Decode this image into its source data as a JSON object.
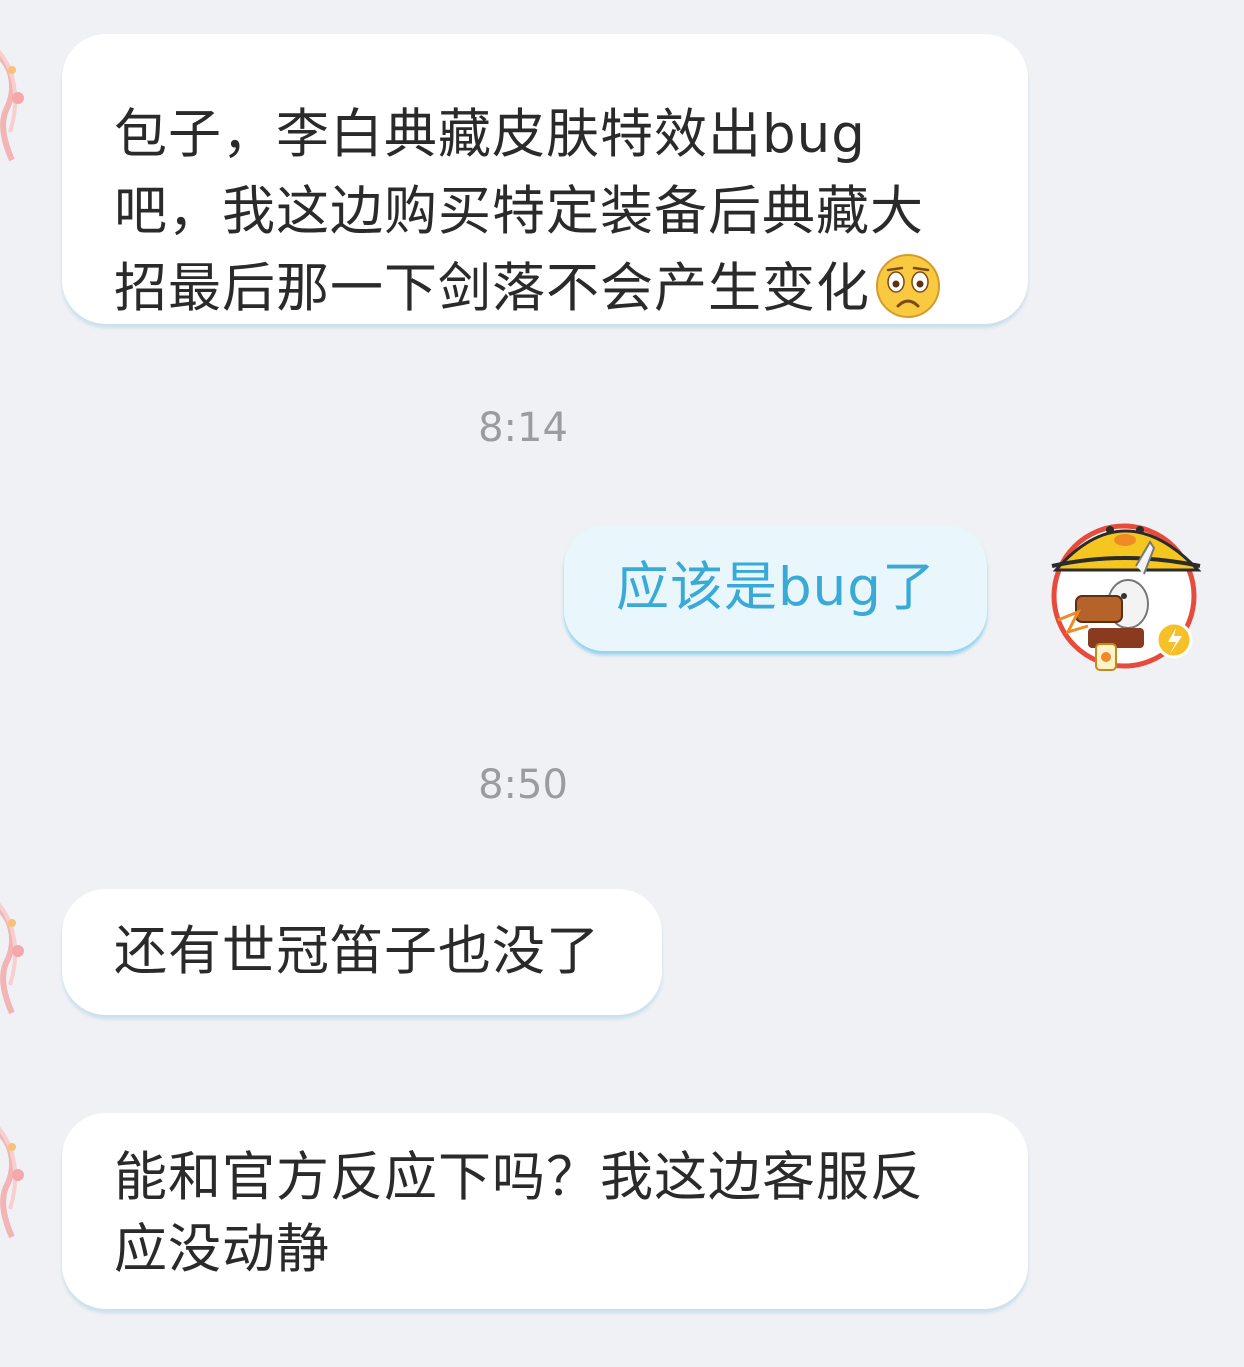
{
  "messages": [
    {
      "direction": "incoming",
      "lines": [
        "包子，李白典藏皮肤特效出bug",
        "吧，我这边购买特定装备后典藏大",
        "招最后那一下剑落不会产生变化"
      ],
      "emoji": "worried-face-emoji"
    },
    {
      "type": "timestamp",
      "text": "8:14"
    },
    {
      "direction": "outgoing",
      "text": "应该是bug了"
    },
    {
      "type": "timestamp",
      "text": "8:50"
    },
    {
      "direction": "incoming",
      "text": "还有世冠笛子也没了"
    },
    {
      "direction": "incoming",
      "lines": [
        "能和官方反应下吗？我这边客服反",
        "应没动静"
      ]
    }
  ],
  "colors": {
    "background": "#f0f1f4",
    "incoming_bubble": "#ffffff",
    "outgoing_bubble": "#e9f7fd",
    "outgoing_text": "#39a9d6",
    "timestamp_text": "#9a9ca1"
  },
  "avatars": {
    "incoming": "pink-character-avatar",
    "outgoing": "duck-hat-rabbit-avatar"
  }
}
